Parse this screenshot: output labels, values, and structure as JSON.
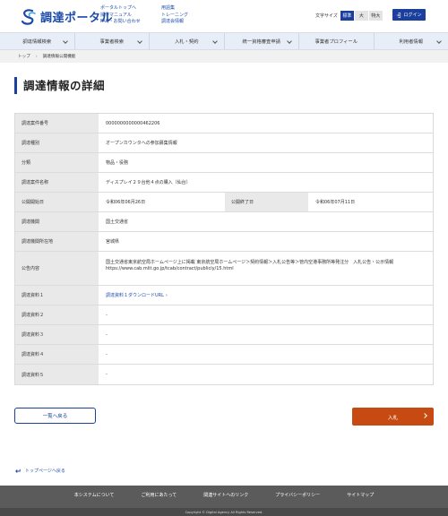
{
  "header": {
    "logo_text": "調達ポータル",
    "links_col1": [
      "ポータルトップへ",
      "操作マニュアル",
      "FAQ・お問い合わせ"
    ],
    "links_col2": [
      "用語集",
      "トレーニング",
      "調達会情報"
    ],
    "font_size_label": "文字サイズ",
    "font_sizes": [
      "標準",
      "大",
      "特大"
    ],
    "login_label": "ログイン",
    "accent": "#1a3f9c"
  },
  "nav": [
    "調達情報検索",
    "事業者検索",
    "入札・契約",
    "統一資格審査申請",
    "事業者プロフィール",
    "利用者情報"
  ],
  "breadcrumb": {
    "home": "トップ",
    "current": "調達情報公開機能"
  },
  "page_title": "調達情報の詳細",
  "details": {
    "case_number_label": "調達案件番号",
    "case_number": "0000000000000462206",
    "type_label": "調達種別",
    "type": "オープンカウンタへの参加募集情報",
    "category_label": "分類",
    "category": "物品・役務",
    "name_label": "調達案件名称",
    "name": "ディスプレイ２９台他４点の購入（仙台）",
    "start_label": "公開開始日",
    "start": "令和06年06月26日",
    "end_label": "公開終了日",
    "end": "令和06年07月11日",
    "agency_label": "調達機関",
    "agency": "国土交通省",
    "location_label": "調達機関所在地",
    "location": "宮城県",
    "notice_label": "公告内容",
    "notice": "国土交通省東京航空局ホームページ上に掲載 東京航空局ホームページ＞契約情報＞入札公告等＞管内空港事務所等発注分　入札公告・公示情報 https://www.cab.mlit.go.jp/tcab/contract/publicly/15.html",
    "doc1_label": "調達資料１",
    "doc1": "調達資料１ダウンロードURL",
    "doc2_label": "調達資料２",
    "doc2": "-",
    "doc3_label": "調達資料３",
    "doc3": "-",
    "doc4_label": "調達資料４",
    "doc4": "-",
    "doc5_label": "調達資料５",
    "doc5": "-"
  },
  "buttons": {
    "back": "一覧へ戻る",
    "bid": "入札",
    "bid_color": "#c84a13"
  },
  "to_top": "トップページへ戻る",
  "footer": {
    "links": [
      "本システムについて",
      "ご利用にあたって",
      "関連サイトへのリンク",
      "プライバシーポリシー",
      "サイトマップ"
    ],
    "copyright": "Copyright © Digital Agency All Rights Reserved."
  }
}
